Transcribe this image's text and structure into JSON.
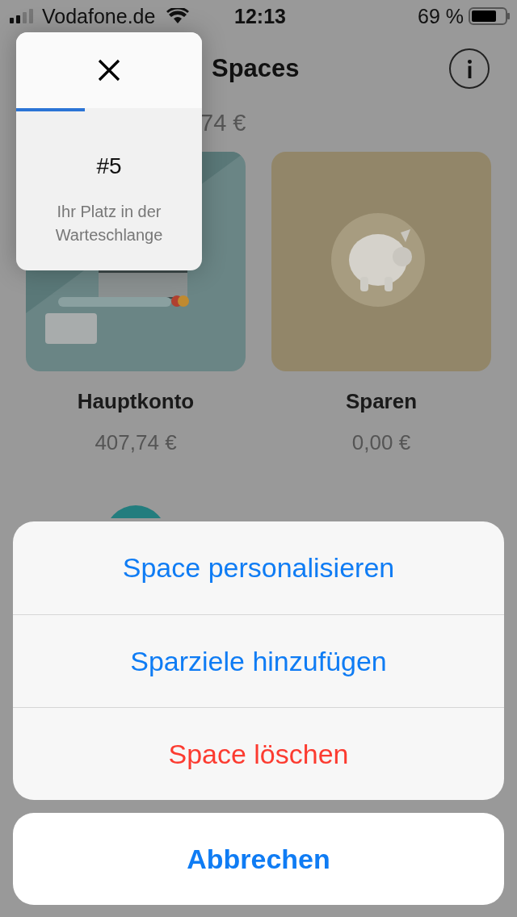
{
  "status_bar": {
    "carrier": "Vodafone.de",
    "time": "12:13",
    "battery": "69 %"
  },
  "header": {
    "title": "Spaces",
    "total": "74 €"
  },
  "spaces": [
    {
      "name": "Hauptkonto",
      "amount": "407,74 €",
      "kind": "picture"
    },
    {
      "name": "Sparen",
      "amount": "0,00 €",
      "kind": "picture"
    }
  ],
  "queue_popup": {
    "position": "#5",
    "caption": "Ihr Platz in der Warteschlange",
    "level": 0.37
  },
  "action_sheet": {
    "actions": [
      {
        "label": "Space personalisieren",
        "kind": "default"
      },
      {
        "label": "Sparziele hinzufügen",
        "kind": "default"
      },
      {
        "label": "Space löschen",
        "kind": "destructive"
      }
    ],
    "cancel": "Abbrechen"
  }
}
